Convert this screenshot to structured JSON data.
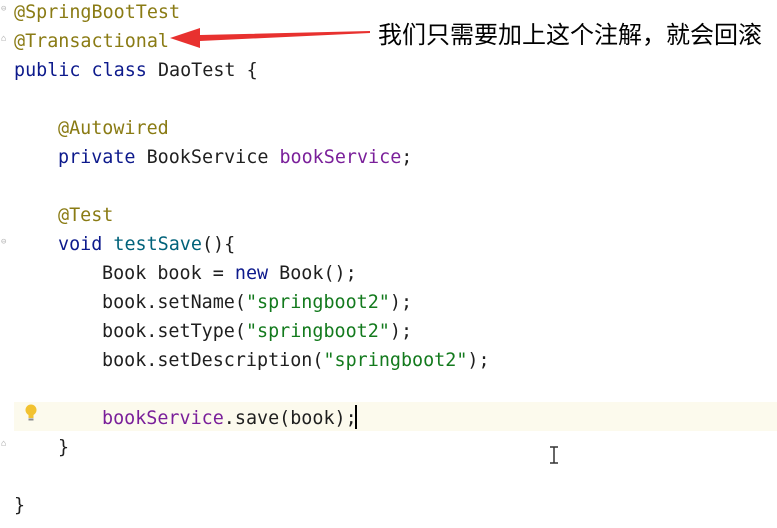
{
  "editor": {
    "lines": [
      {
        "type": "annotation",
        "text": "@SpringBootTest"
      },
      {
        "type": "annotation",
        "text": "@Transactional"
      },
      {
        "type": "class",
        "kw1": "public",
        "kw2": "class",
        "name": "DaoTest",
        "brace": "{"
      },
      {
        "type": "blank"
      },
      {
        "type": "annotation",
        "text": "@Autowired"
      },
      {
        "type": "field",
        "kw": "private",
        "type_name": "BookService",
        "field": "bookService",
        "end": ";"
      },
      {
        "type": "blank"
      },
      {
        "type": "annotation",
        "text": "@Test"
      },
      {
        "type": "method",
        "kw": "void",
        "name": "testSave",
        "end": "(){"
      },
      {
        "type": "stmt",
        "text": "Book book = ",
        "kw": "new",
        "rest": " Book();"
      },
      {
        "type": "call",
        "text": "book.setName(",
        "str": "\"springboot2\"",
        "end": ");"
      },
      {
        "type": "call",
        "text": "book.setType(",
        "str": "\"springboot2\"",
        "end": ");"
      },
      {
        "type": "call",
        "text": "book.setDescription(",
        "str": "\"springboot2\"",
        "end": ");"
      },
      {
        "type": "blank"
      },
      {
        "type": "savecall",
        "field": "bookService",
        "rest": ".save(book);"
      },
      {
        "type": "close",
        "text": "}"
      },
      {
        "type": "blank"
      },
      {
        "type": "close",
        "text": "}"
      }
    ]
  },
  "annotation_note": {
    "text": "我们只需要加上这个注解，就会回滚",
    "arrow_color": "#e8312f"
  },
  "colors": {
    "keyword": "#0d1a8c",
    "annotation": "#8a7b14",
    "field": "#7a1f9a",
    "string": "#137a1d",
    "caret_line": "#fcfaed"
  },
  "icons": [
    "lightbulb-icon",
    "fold-marker-icon",
    "text-cursor-icon",
    "red-arrow-icon"
  ]
}
